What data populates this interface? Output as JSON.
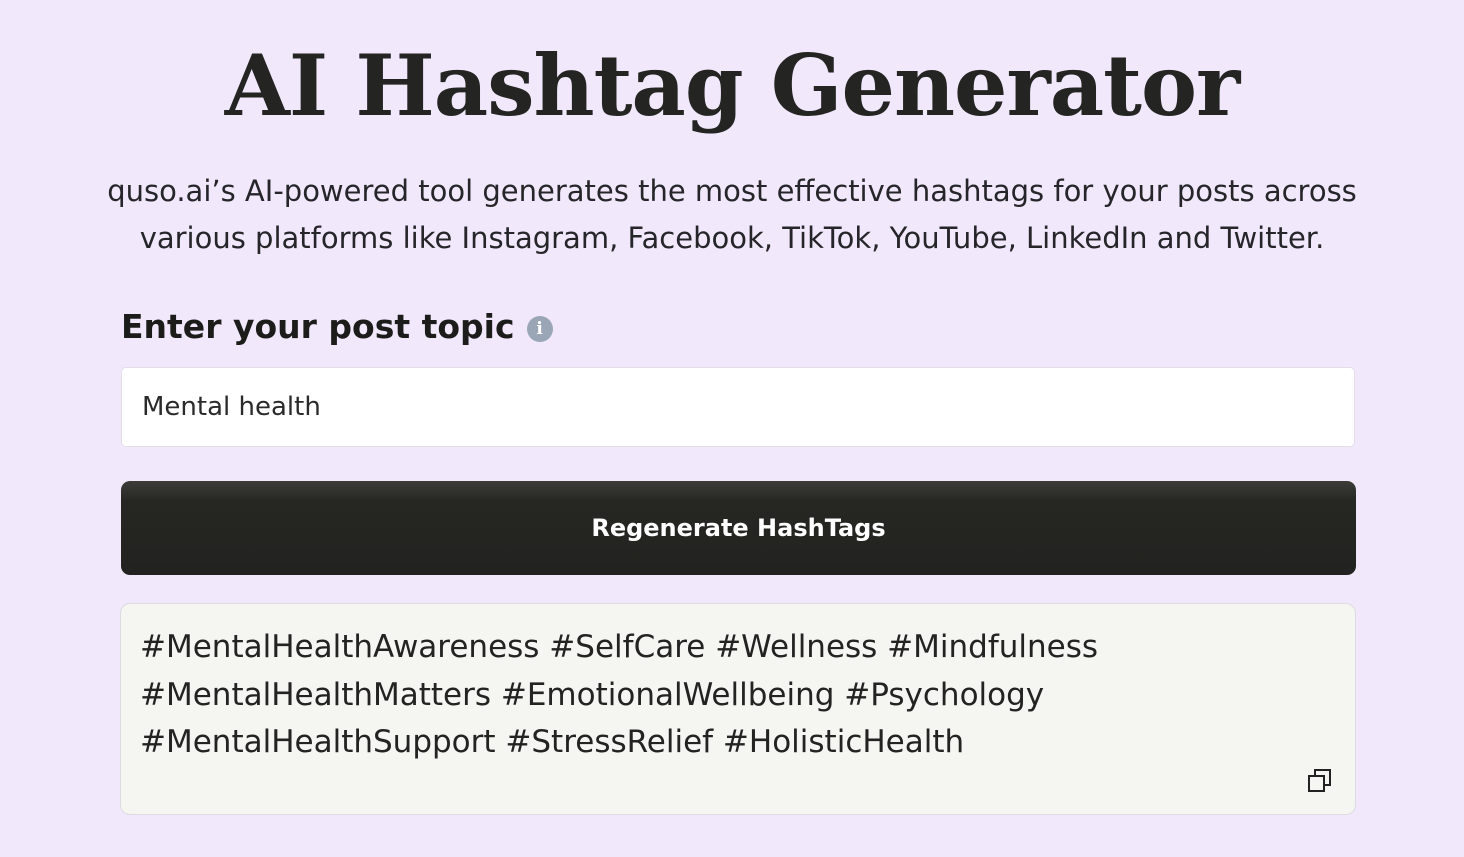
{
  "header": {
    "title": "AI Hashtag Generator",
    "subtitle": "quso.ai’s AI-powered tool generates the most effective hashtags for your posts across various platforms like Instagram, Facebook, TikTok, YouTube, LinkedIn and Twitter."
  },
  "form": {
    "label": "Enter your post topic",
    "info_icon": "info-icon",
    "input_value": "Mental health",
    "button_label": "Regenerate HashTags"
  },
  "result": {
    "hashtags": "#MentalHealthAwareness #SelfCare #Wellness #Mindfulness #MentalHealthMatters #EmotionalWellbeing #Psychology #MentalHealthSupport #StressRelief #HolisticHealth",
    "copy_icon": "copy-icon"
  },
  "colors": {
    "background": "#f1e8fb",
    "button": "#222220",
    "result_background": "#f5f6f1"
  }
}
